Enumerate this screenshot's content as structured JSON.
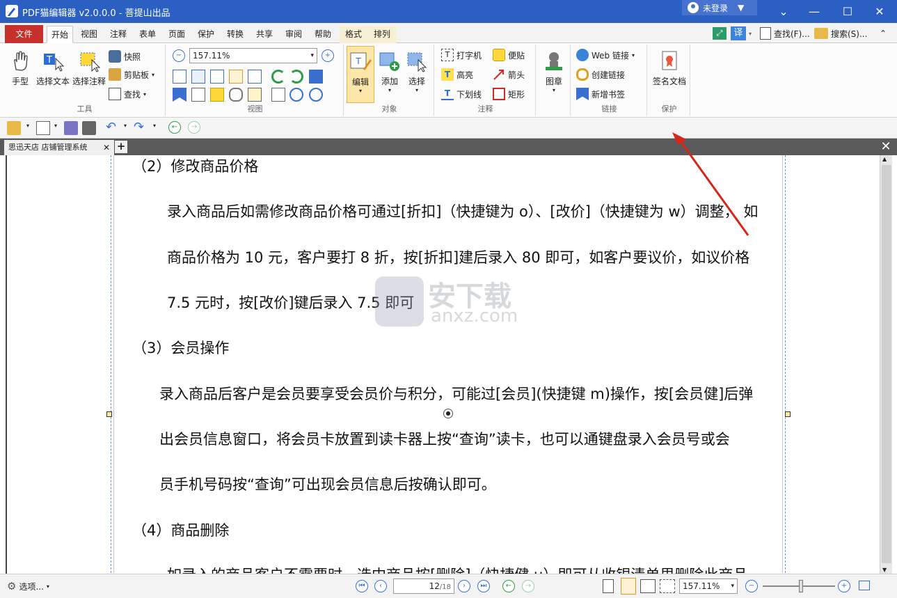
{
  "app": {
    "title": "PDF猫编辑器 v2.0.0.0 - 菩提山出品",
    "login_label": "未登录",
    "accent": "#2b5fc2"
  },
  "menu": {
    "file": "文件",
    "tabs": [
      "开始",
      "视图",
      "注释",
      "表单",
      "页面",
      "保护",
      "转换",
      "共享",
      "审阅",
      "帮助",
      "格式",
      "排列"
    ],
    "translate": "译",
    "find": "查找(F)...",
    "search": "搜索(S)..."
  },
  "ribbon": {
    "tools": {
      "hand": "手型",
      "select_text": "选择文本",
      "select_annot": "选择注释",
      "snapshot": "快照",
      "clipboard": "剪贴板",
      "find": "查找",
      "label": "工具"
    },
    "view": {
      "zoom": "157.11%",
      "label": "视图"
    },
    "objects": {
      "edit": "编辑",
      "add": "添加",
      "select": "选择",
      "label": "对象"
    },
    "annotations": {
      "typewriter": "打字机",
      "note": "便贴",
      "highlight": "高亮",
      "arrow": "箭头",
      "underline": "下划线",
      "rect": "矩形",
      "label": "注释"
    },
    "stamp": "图章",
    "links": {
      "web": "Web 链接",
      "create": "创建链接",
      "bookmark": "新增书签",
      "label": "链接"
    },
    "protect": {
      "sign": "签名文档",
      "label": "保护"
    }
  },
  "document": {
    "tab_name": "思迅天店 店铺管理系统",
    "lines": [
      "（2）修改商品价格",
      "录入商品后如需修改商品价格可通过[折扣]（快捷键为 o）、[改价]（快捷键为 w）调整，  如",
      "商品价格为 10 元，客户要打 8 折，按[折扣]建后录入 80 即可，如客户要议价，如议价格",
      "7.5 元时，按[改价]键后录入 7.5 即可",
      "（3）会员操作",
      "录入商品后客户是会员要享受会员价与积分，可能过[会员](快捷键 m)操作，按[会员健]后弹",
      "出会员信息窗口，将会员卡放置到读卡器上按“查询”读卡，也可以通键盘录入会员号或会",
      "员手机号码按“查询”可出现会员信息后按确认即可。",
      "（4）商品删除",
      "如录入的商品客户不需要时，选中商品按[删除]（快捷健 u）即可从收银清单里删除此商品"
    ],
    "watermark_main": "安下载",
    "watermark_sub": "anxz.com"
  },
  "status": {
    "options": "选项...",
    "page_current": "12",
    "page_total": "18",
    "zoom": "157.11%"
  }
}
